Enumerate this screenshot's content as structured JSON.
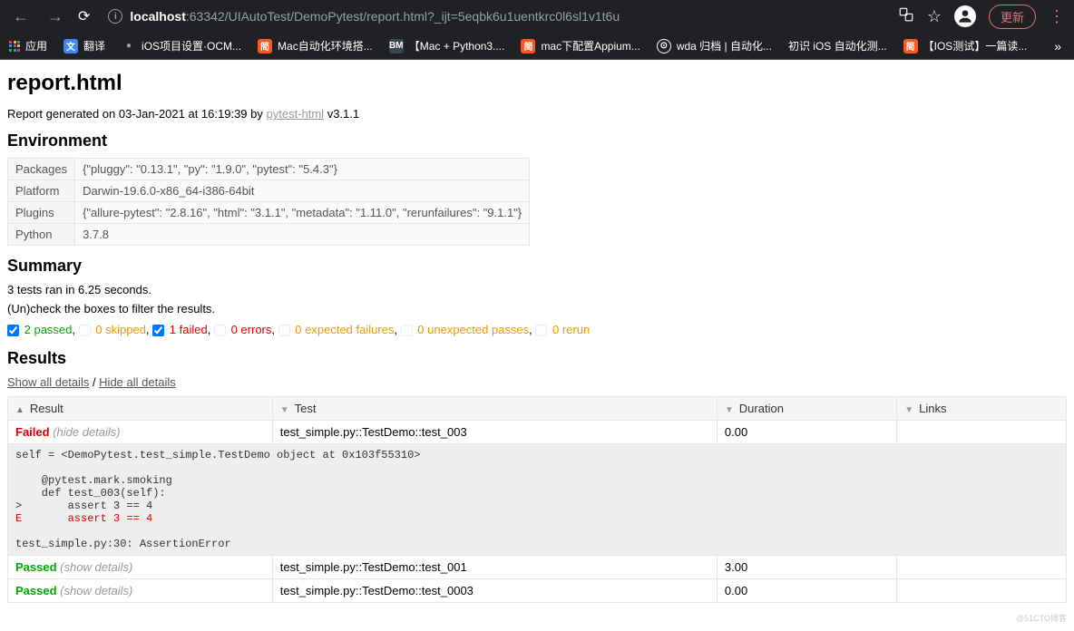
{
  "browser": {
    "url_host": "localhost",
    "url_port": ":63342",
    "url_path": "/UIAutoTest/DemoPytest/report.html?_ijt=5eqbk6u1uentkrc0l6sl1v1t6u",
    "update_label": "更新"
  },
  "bookmarks": {
    "apps": "应用",
    "items": [
      {
        "label": "翻译",
        "icon": "fav-blue",
        "glyph": "文"
      },
      {
        "label": "iOS项目设置·OCM...",
        "icon": "fav-dark",
        "glyph": "●"
      },
      {
        "label": "Mac自动化环境搭...",
        "icon": "fav-orange",
        "glyph": "简"
      },
      {
        "label": "【Mac + Python3....",
        "icon": "fav-dark",
        "glyph": "BM"
      },
      {
        "label": "mac下配置Appium...",
        "icon": "fav-orange",
        "glyph": "简"
      },
      {
        "label": "wda 归档 | 自动化...",
        "icon": "fav-globe",
        "glyph": "⊙"
      },
      {
        "label": "初识 iOS 自动化测...",
        "icon": "",
        "glyph": ""
      },
      {
        "label": "【IOS测试】一篇读...",
        "icon": "fav-orange",
        "glyph": "简"
      }
    ]
  },
  "report": {
    "title": "report.html",
    "generated_prefix": "Report generated on 03-Jan-2021 at 16:19:39 by ",
    "generator_link": "pytest-html",
    "generator_version": " v3.1.1",
    "env_heading": "Environment",
    "env": [
      {
        "key": "Packages",
        "value": "{\"pluggy\": \"0.13.1\", \"py\": \"1.9.0\", \"pytest\": \"5.4.3\"}"
      },
      {
        "key": "Platform",
        "value": "Darwin-19.6.0-x86_64-i386-64bit"
      },
      {
        "key": "Plugins",
        "value": "{\"allure-pytest\": \"2.8.16\", \"html\": \"3.1.1\", \"metadata\": \"1.11.0\", \"rerunfailures\": \"9.1.1\"}"
      },
      {
        "key": "Python",
        "value": "3.7.8"
      }
    ],
    "summary_heading": "Summary",
    "summary_line": "3 tests ran in 6.25 seconds.",
    "filter_hint": "(Un)check the boxes to filter the results.",
    "filters": {
      "passed": "2 passed",
      "skipped": "0 skipped",
      "failed": "1 failed",
      "errors": "0 errors",
      "xfailed": "0 expected failures",
      "xpassed": "0 unexpected passes",
      "rerun": "0 rerun"
    },
    "results_heading": "Results",
    "show_all": "Show all details",
    "hide_all": "Hide all details",
    "columns": {
      "result": "Result",
      "test": "Test",
      "duration": "Duration",
      "links": "Links"
    },
    "rows": [
      {
        "result": "Failed",
        "detail": "(hide details)",
        "test": "test_simple.py::TestDemo::test_003",
        "duration": "0.00"
      },
      {
        "result": "Passed",
        "detail": "(show details)",
        "test": "test_simple.py::TestDemo::test_001",
        "duration": "3.00"
      },
      {
        "result": "Passed",
        "detail": "(show details)",
        "test": "test_simple.py::TestDemo::test_0003",
        "duration": "0.00"
      }
    ],
    "traceback": {
      "l1": "self = <DemoPytest.test_simple.TestDemo object at 0x103f55310>",
      "l2": "    @pytest.mark.smoking",
      "l3": "    def test_003(self):",
      "l4": ">       assert 3 == 4",
      "l5": "E       assert 3 == 4",
      "l6": "test_simple.py:30: AssertionError"
    }
  },
  "watermark": "@51CTO博客"
}
